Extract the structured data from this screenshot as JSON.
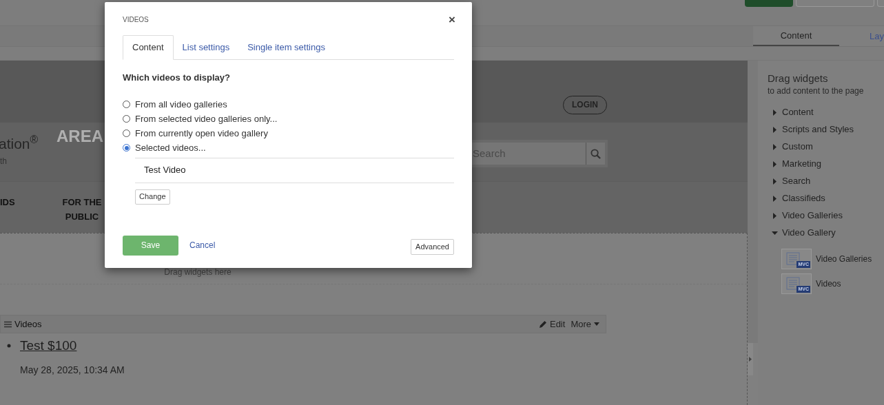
{
  "toolbar": {
    "tabs": [
      {
        "label": "Content",
        "selected": true
      },
      {
        "label": "Lay",
        "selected": false
      }
    ]
  },
  "site": {
    "login": "LOGIN",
    "logo_text": "ation$^{®}$",
    "logo_subtext": "th",
    "area_title": "AREA",
    "search_placeholder": "Search",
    "nav": [
      "IDS",
      "FOR THE PUBLIC"
    ]
  },
  "canvas": {
    "drop_hint": "Drag widgets here",
    "widget": {
      "title": "Videos",
      "edit": "Edit",
      "more": "More",
      "items": [
        {
          "title": "Test $100",
          "date": "May 28, 2025, 10:34 AM"
        }
      ]
    }
  },
  "sidebar": {
    "title": "Drag widgets",
    "subtitle": "to add content to the page",
    "groups": [
      {
        "label": "Content",
        "expanded": false
      },
      {
        "label": "Scripts and Styles",
        "expanded": false
      },
      {
        "label": "Custom",
        "expanded": false
      },
      {
        "label": "Marketing",
        "expanded": false
      },
      {
        "label": "Search",
        "expanded": false
      },
      {
        "label": "Classifieds",
        "expanded": false
      },
      {
        "label": "Video Galleries",
        "expanded": false
      },
      {
        "label": "Video Gallery",
        "expanded": true,
        "widgets": [
          {
            "label": "Video Galleries",
            "badge": "MVC"
          },
          {
            "label": "Videos",
            "badge": "MVC"
          }
        ]
      }
    ]
  },
  "dialog": {
    "title": "VIDEOS",
    "close": "×",
    "tabs": [
      {
        "label": "Content",
        "selected": true
      },
      {
        "label": "List settings",
        "selected": false
      },
      {
        "label": "Single item settings",
        "selected": false
      }
    ],
    "question": "Which videos to display?",
    "options": [
      {
        "label": "From all video galleries",
        "selected": false
      },
      {
        "label": "From selected video galleries only...",
        "selected": false
      },
      {
        "label": "From currently open video gallery",
        "selected": false
      },
      {
        "label": "Selected videos...",
        "selected": true
      }
    ],
    "selected_items": [
      "Test Video"
    ],
    "change": "Change",
    "save": "Save",
    "cancel": "Cancel",
    "advanced": "Advanced"
  }
}
